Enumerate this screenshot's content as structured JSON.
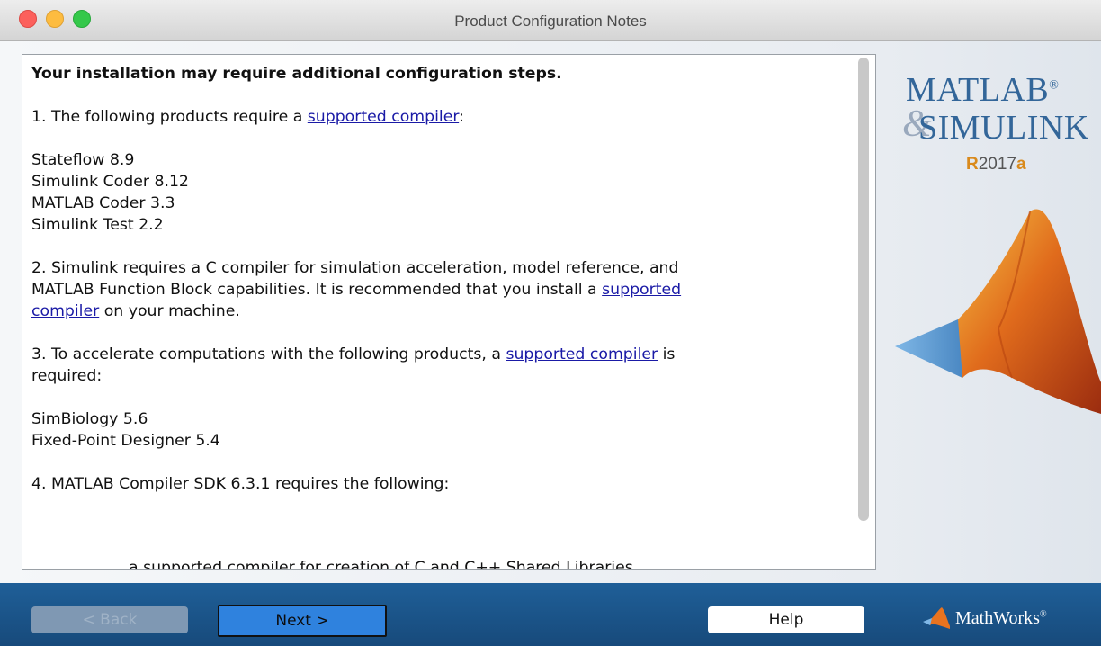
{
  "window": {
    "title": "Product Configuration Notes"
  },
  "notes": {
    "heading": "Your installation may require additional configuration steps.",
    "item1_prefix": "1. The following products require a ",
    "item1_link": "supported compiler",
    "item1_suffix": ":",
    "compiler_products": [
      "Stateflow 8.9",
      "Simulink Coder 8.12",
      "MATLAB Coder 3.3",
      "Simulink Test 2.2"
    ],
    "item2_line1": "2. Simulink requires a C compiler for simulation acceleration, model reference, and",
    "item2_line2_prefix": "MATLAB Function Block capabilities. It is recommended that you install a ",
    "item2_link_part1": "supported",
    "item2_link_part2": "compiler",
    "item2_line3_suffix": " on your machine.",
    "item3_prefix": "3. To accelerate computations with the following products, a ",
    "item3_link": "supported compiler",
    "item3_suffix": " is",
    "item3_line2": "required:",
    "accel_products": [
      "SimBiology 5.6",
      "Fixed-Point Designer 5.4"
    ],
    "item4": "4. MATLAB Compiler SDK 6.3.1 requires the following:",
    "cutoff_line": "a supported compiler for creation of C and C++ Shared Libraries"
  },
  "logo": {
    "matlab": "MATLAB",
    "registered": "®",
    "amp": "&",
    "simulink": "SIMULINK",
    "release_r": "R",
    "release_year": "2017",
    "release_a": "a"
  },
  "buttons": {
    "back": "< Back",
    "next": "Next >",
    "help": "Help"
  },
  "brand": {
    "mathworks": "MathWorks",
    "mathworks_mark": "®"
  }
}
